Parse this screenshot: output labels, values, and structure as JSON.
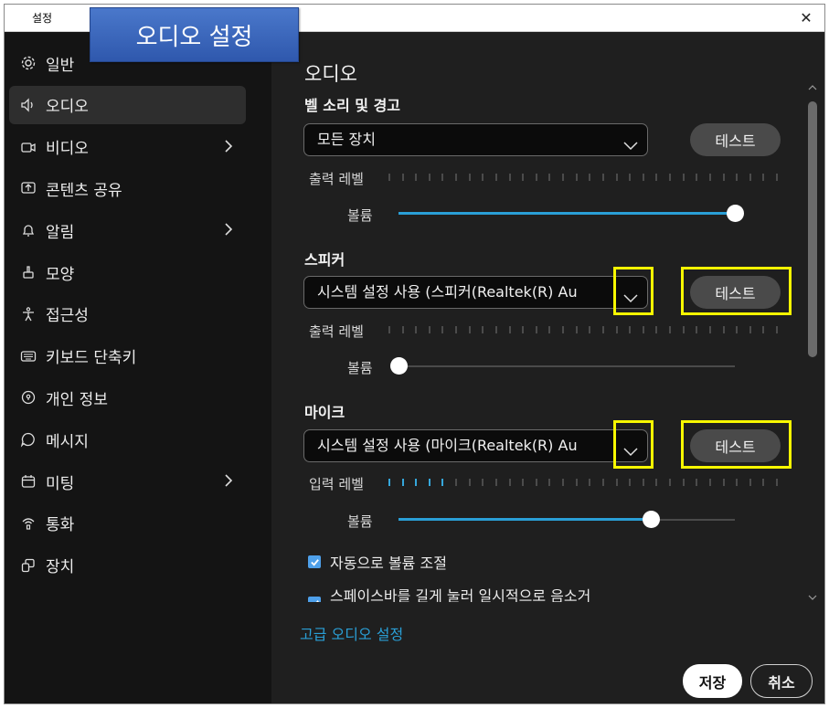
{
  "window": {
    "title": "설정",
    "close_glyph": "✕"
  },
  "banner": {
    "text": "오디오 설정"
  },
  "sidebar": {
    "items": [
      {
        "label": "일반",
        "icon": "gear-icon",
        "has_chevron": false,
        "active": false
      },
      {
        "label": "오디오",
        "icon": "speaker-icon",
        "has_chevron": false,
        "active": true
      },
      {
        "label": "비디오",
        "icon": "video-camera-icon",
        "has_chevron": true,
        "active": false
      },
      {
        "label": "콘텐츠 공유",
        "icon": "share-screen-icon",
        "has_chevron": false,
        "active": false
      },
      {
        "label": "알림",
        "icon": "bell-icon",
        "has_chevron": true,
        "active": false
      },
      {
        "label": "모양",
        "icon": "brush-icon",
        "has_chevron": false,
        "active": false
      },
      {
        "label": "접근성",
        "icon": "accessibility-icon",
        "has_chevron": false,
        "active": false
      },
      {
        "label": "키보드 단축키",
        "icon": "keyboard-icon",
        "has_chevron": false,
        "active": false
      },
      {
        "label": "개인 정보",
        "icon": "privacy-icon",
        "has_chevron": false,
        "active": false
      },
      {
        "label": "메시지",
        "icon": "message-icon",
        "has_chevron": false,
        "active": false
      },
      {
        "label": "미팅",
        "icon": "calendar-icon",
        "has_chevron": true,
        "active": false
      },
      {
        "label": "통화",
        "icon": "phone-icon",
        "has_chevron": false,
        "active": false
      },
      {
        "label": "장치",
        "icon": "devices-icon",
        "has_chevron": false,
        "active": false
      }
    ]
  },
  "main": {
    "title": "오디오",
    "ringer": {
      "heading": "벨 소리 및 경고",
      "device": "모든 장치",
      "test_label": "테스트",
      "level_label": "출력 레벨",
      "level_active": 0,
      "volume_label": "볼륨",
      "volume": 1.0
    },
    "speaker": {
      "heading": "스피커",
      "device": "시스템 설정 사용 (스피커(Realtek(R) Au",
      "test_label": "테스트",
      "level_label": "출력 레벨",
      "level_active": 0,
      "volume_label": "볼륨",
      "volume": 0.0
    },
    "microphone": {
      "heading": "마이크",
      "device": "시스템 설정 사용 (마이크(Realtek(R) Au",
      "test_label": "테스트",
      "level_label": "입력 레벨",
      "level_active": 5,
      "volume_label": "볼륨",
      "volume": 0.75
    },
    "auto_volume": {
      "label": "자동으로 볼륨 조절",
      "checked": true
    },
    "space_mute": {
      "label": "스페이스바를 길게 눌러 일시적으로 음소거",
      "checked": true
    },
    "advanced_link": "고급 오디오 설정",
    "level_tick_count": 30,
    "accent_color": "#2a9fd6",
    "highlight_color": "#f7f700"
  },
  "footer": {
    "save_label": "저장",
    "cancel_label": "취소"
  }
}
